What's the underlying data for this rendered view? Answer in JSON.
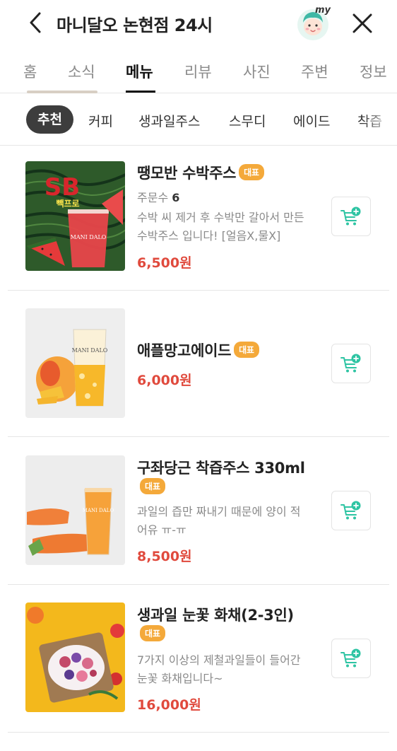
{
  "header": {
    "back_icon": "chevron-left-icon",
    "title": "마니달오 논현점 24시",
    "my_label": "my",
    "close_icon": "close-icon"
  },
  "tabs": [
    {
      "label": "홈"
    },
    {
      "label": "소식"
    },
    {
      "label": "메뉴",
      "active": true
    },
    {
      "label": "리뷰"
    },
    {
      "label": "사진"
    },
    {
      "label": "주변"
    },
    {
      "label": "정보"
    }
  ],
  "categories": [
    {
      "label": "추천",
      "active": true
    },
    {
      "label": "커피"
    },
    {
      "label": "생과일주스"
    },
    {
      "label": "스무디"
    },
    {
      "label": "에이드"
    },
    {
      "label": "착즙"
    }
  ],
  "colors": {
    "badge": "#f4a93a",
    "price": "#e04a3d",
    "cart_icon": "#2ec4a3",
    "active_category_bg": "#3d3d3d"
  },
  "menu": [
    {
      "name": "땡모반 수박주스",
      "badge": "대표",
      "order_label": "주문수",
      "order_count": "6",
      "desc": "수박 씨 제거 후 수박만 갈아서 만든 수박주스 입니다! [얼음X,물X]",
      "price": "6,500원",
      "image_text": {
        "big": "SB",
        "small": "빽프로",
        "cup": "MANI DALO"
      }
    },
    {
      "name": "애플망고에이드",
      "badge": "대표",
      "price": "6,000원",
      "image_text": {
        "cup": "MANI DALO"
      }
    },
    {
      "name": "구좌당근 착즙주스 330ml",
      "badge": "대표",
      "desc": "과일의 즙만 짜내기 때문에 양이 적어유 ㅠ-ㅠ",
      "price": "8,500원",
      "image_text": {
        "cup": "MANI DALO"
      }
    },
    {
      "name": "생과일 눈꽃 화채(2-3인)",
      "badge": "대표",
      "desc": "7가지 이상의 제철과일들이 들어간 눈꽃 화채입니다~",
      "price": "16,000원"
    }
  ]
}
